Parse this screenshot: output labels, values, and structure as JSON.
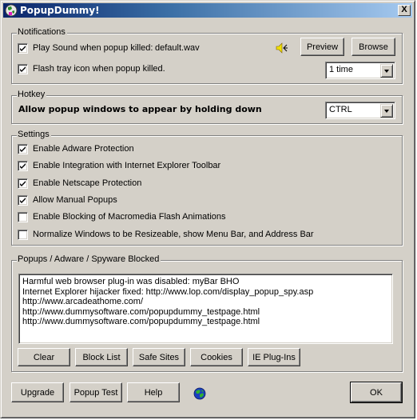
{
  "window": {
    "title": "PopupDummy!",
    "close_label": "X"
  },
  "notifications": {
    "legend": "Notifications",
    "play_sound": {
      "label": "Play Sound when popup killed:",
      "checked": true,
      "file": "default.wav"
    },
    "flash_tray": {
      "label": "Flash tray icon when popup killed.",
      "checked": true
    },
    "preview_label": "Preview",
    "browse_label": "Browse",
    "flash_count": "1 time",
    "icons": {
      "speaker": "speaker-icon"
    }
  },
  "hotkey": {
    "legend": "Hotkey",
    "label": "Allow popup windows to appear by holding down",
    "key": "CTRL"
  },
  "settings": {
    "legend": "Settings",
    "items": [
      {
        "label": "Enable Adware Protection",
        "checked": true
      },
      {
        "label": "Enable Integration with Internet Explorer Toolbar",
        "checked": true
      },
      {
        "label": "Enable Netscape Protection",
        "checked": true
      },
      {
        "label": "Allow Manual Popups",
        "checked": true
      },
      {
        "label": "Enable Blocking of Macromedia Flash Animations",
        "checked": false
      },
      {
        "label": "Normalize Windows to be Resizeable, show Menu Bar, and Address Bar",
        "checked": false
      }
    ]
  },
  "blocked": {
    "legend": "Popups / Adware / Spyware Blocked",
    "entries": [
      "Harmful web browser plug-in was disabled: myBar BHO",
      "Internet Explorer hijacker fixed: http://www.lop.com/display_popup_spy.asp",
      "http://www.arcadeathome.com/",
      "http://www.dummysoftware.com/popupdummy_testpage.html",
      "http://www.dummysoftware.com/popupdummy_testpage.html"
    ],
    "buttons": {
      "clear": "Clear",
      "block_list": "Block List",
      "safe_sites": "Safe Sites",
      "cookies": "Cookies",
      "ie_plugins": "IE Plug-Ins"
    }
  },
  "footer": {
    "upgrade": "Upgrade",
    "popup_test": "Popup Test",
    "help": "Help",
    "ok": "OK",
    "icons": {
      "globe": "globe-icon"
    }
  }
}
